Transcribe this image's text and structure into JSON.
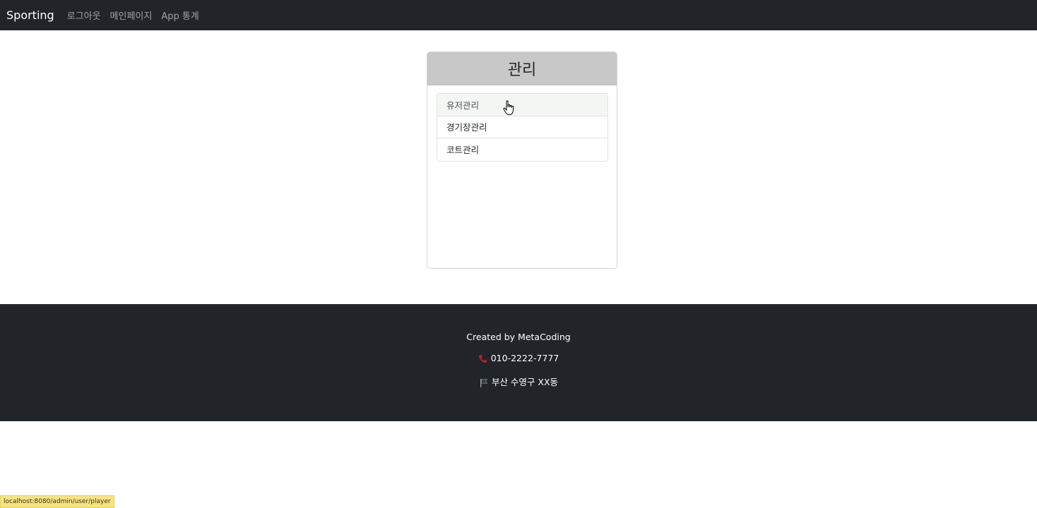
{
  "navbar": {
    "brand": "Sporting",
    "links": [
      "로그아웃",
      "메인페이지",
      "App 통계"
    ]
  },
  "card": {
    "title": "관리",
    "items": [
      "유저관리",
      "경기장관리",
      "코트관리"
    ]
  },
  "footer": {
    "created_by": "Created by MetaCoding",
    "phone": "010-2222-7777",
    "address": "부산 수영구 XX동"
  },
  "status_bar": {
    "url": "localhost:8080/admin/user/player"
  },
  "colors": {
    "navbar_bg": "#212529",
    "card_header_bg": "#c8c8c8",
    "status_bar_bg": "#f7e480"
  },
  "icons": [
    "phone-icon",
    "flag-icon",
    "hand-cursor-icon"
  ]
}
